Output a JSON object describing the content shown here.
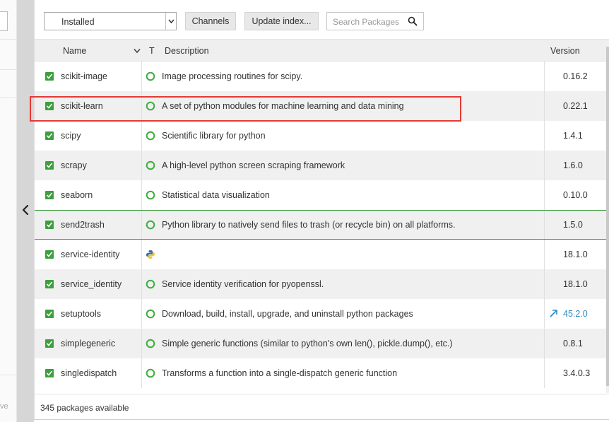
{
  "left_panel": {
    "clipped_text": "ve"
  },
  "toolbar": {
    "filter_value": "Installed",
    "channels_label": "Channels",
    "update_index_label": "Update index...",
    "search_placeholder": "Search Packages"
  },
  "table": {
    "headers": {
      "name": "Name",
      "type": "T",
      "description": "Description",
      "version": "Version"
    },
    "rows": [
      {
        "name": "scikit-image",
        "status_icon": "installed-ring-icon",
        "description": "Image processing routines for scipy.",
        "version": "0.16.2"
      },
      {
        "name": "scikit-learn",
        "status_icon": "installed-ring-icon",
        "description": "A set of python modules for machine learning and data mining",
        "version": "0.22.1"
      },
      {
        "name": "scipy",
        "status_icon": "installed-ring-icon",
        "description": "Scientific library for python",
        "version": "1.4.1"
      },
      {
        "name": "scrapy",
        "status_icon": "installed-ring-icon",
        "description": "A high-level python screen scraping framework",
        "version": "1.6.0"
      },
      {
        "name": "seaborn",
        "status_icon": "installed-ring-icon",
        "description": "Statistical data visualization",
        "version": "0.10.0"
      },
      {
        "name": "send2trash",
        "status_icon": "installed-ring-icon",
        "description": "Python library to natively send files to trash (or recycle bin) on all platforms.",
        "version": "1.5.0"
      },
      {
        "name": "service-identity",
        "status_icon": "python-icon",
        "description": "",
        "version": "18.1.0"
      },
      {
        "name": "service_identity",
        "status_icon": "installed-ring-icon",
        "description": "Service identity verification for pyopenssl.",
        "version": "18.1.0"
      },
      {
        "name": "setuptools",
        "status_icon": "installed-ring-icon",
        "description": "Download, build, install, upgrade, and uninstall python packages",
        "version": "45.2.0",
        "update_available": true
      },
      {
        "name": "simplegeneric",
        "status_icon": "installed-ring-icon",
        "description": "Simple generic functions (similar to python's own len(), pickle.dump(), etc.)",
        "version": "0.8.1"
      },
      {
        "name": "singledispatch",
        "status_icon": "installed-ring-icon",
        "description": "Transforms a function into a single-dispatch generic function",
        "version": "3.4.0.3"
      }
    ]
  },
  "footer": {
    "status": "345 packages available"
  },
  "colors": {
    "checkbox": "#3d9f3d",
    "status_ring": "#3fae3f",
    "highlight": "#e53935",
    "update_version": "#2a8bbf",
    "selection_line": "#3b9b3b"
  }
}
